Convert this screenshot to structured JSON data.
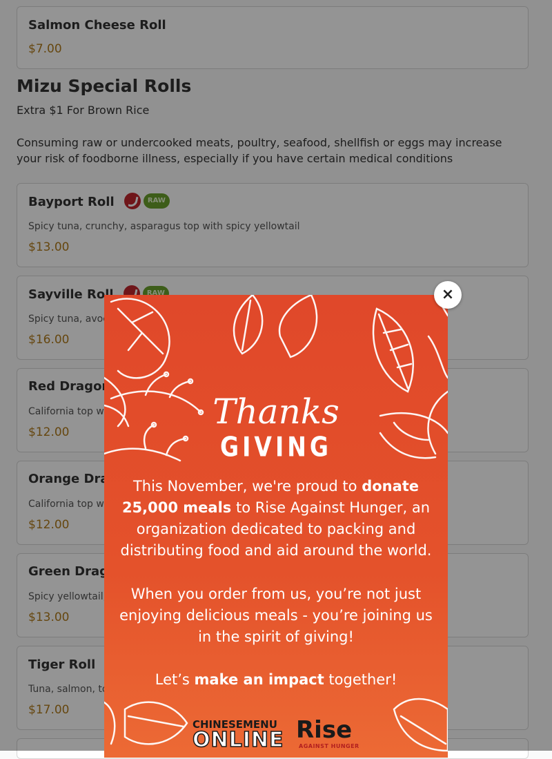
{
  "menu": {
    "top_item": {
      "name": "Salmon Cheese Roll",
      "price": "$7.00"
    },
    "section": {
      "title": "Mizu Special Rolls",
      "note": "Extra $1 For Brown Rice",
      "warning": "Consuming raw or undercooked meats, poultry, seafood, shellfish or eggs may increase your risk of foodborne illness, especially if you have certain medical conditions"
    },
    "items": [
      {
        "name": "Bayport Roll",
        "desc": "Spicy tuna, crunchy, asparagus top with spicy yellowtail",
        "price": "$13.00",
        "raw_label": "RAW"
      },
      {
        "name": "Sayville Roll",
        "desc": "Spicy tuna, avocad",
        "price": "$16.00",
        "raw_label": "RAW"
      },
      {
        "name": "Red Dragon",
        "desc": "California top with",
        "price": "$12.00"
      },
      {
        "name": "Orange Drag",
        "desc": "California top with",
        "price": "$12.00"
      },
      {
        "name": "Green Dragon",
        "desc": "Spicy yellowtail, e",
        "price": "$13.00"
      },
      {
        "name": "Tiger Roll",
        "desc": "Tuna, salmon, top",
        "price": "$17.00"
      }
    ]
  },
  "popup": {
    "close_label": "×",
    "heading_script": "Thanks",
    "heading_caps": "GIVING",
    "para1": {
      "a": "This November, we're proud to ",
      "b": "donate 25,000 meals",
      "c": " to Rise Against Hunger, an organization dedicated to packing and distributing food and aid around the world."
    },
    "para2": "When you order from us, you’re not just enjoying delicious meals - you’re joining us in the spirit of giving!",
    "para3": {
      "a": "Let’s ",
      "b": "make an impact",
      "c": " together!"
    },
    "logo1": {
      "top": "CHINESEMENU",
      "bottom": "ONLINE"
    },
    "logo2": {
      "main": "Rise",
      "sub": "AGAINST HUNGER"
    }
  },
  "colors": {
    "accent_price": "#b07a1a",
    "spicy": "#c0262d",
    "raw_badge": "#6aa12b",
    "popup_bg": "#e4522b"
  }
}
